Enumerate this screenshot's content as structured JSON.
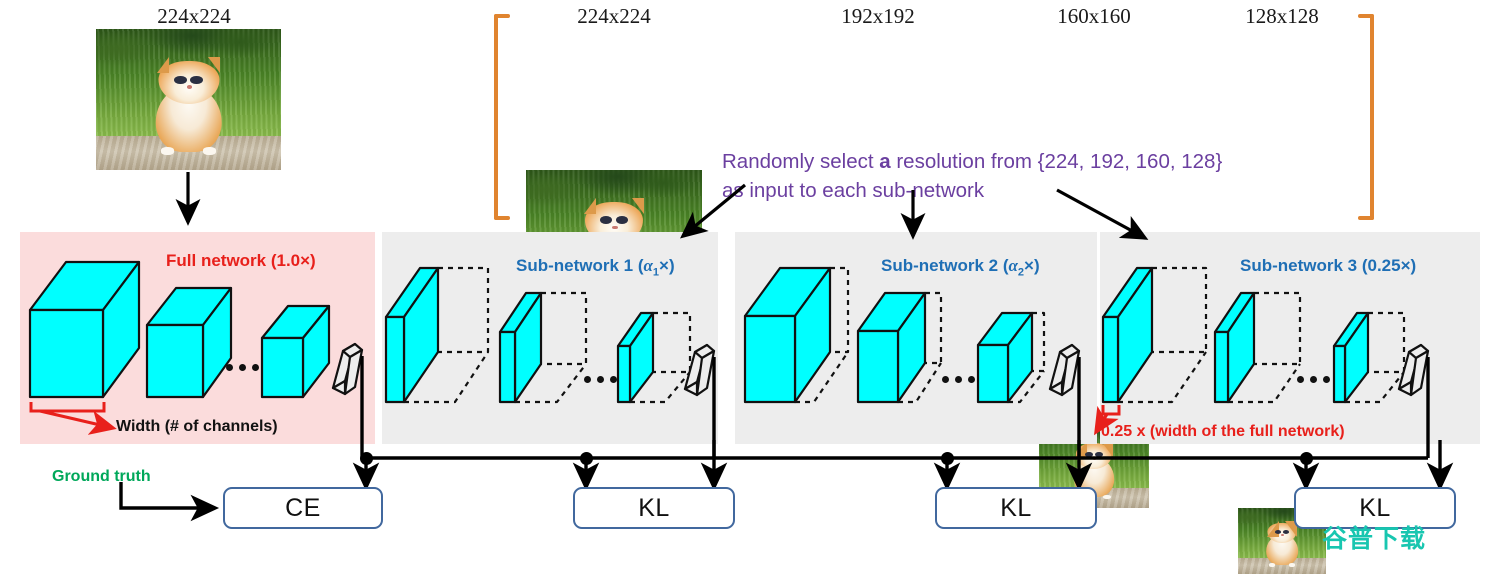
{
  "top_inputs": {
    "full_network_input": {
      "label": "224x224"
    },
    "bracket_group": [
      {
        "label": "224x224"
      },
      {
        "label": "192x192"
      },
      {
        "label": "160x160"
      },
      {
        "label": "128x128"
      }
    ]
  },
  "caption": {
    "line1_a": "Randomly select ",
    "line1_b": "a",
    "line1_c": " resolution from {224, 192, 160, 128}",
    "line2": "as input to each sub-network",
    "color": "#6B3FA0"
  },
  "panels": [
    {
      "id": "full",
      "title": "Full network (1.0×)",
      "title_color": "#E8201B",
      "bg": "#FBDCDC",
      "annotation": "Width (# of channels)",
      "annotation_color": "#121212"
    },
    {
      "id": "sub1",
      "title_prefix": "Sub-network 1 (",
      "title_sym": "α",
      "title_sub": "1",
      "title_suffix": "×)",
      "title_color": "#1F6FB5",
      "bg": "#EDEDED"
    },
    {
      "id": "sub2",
      "title_prefix": "Sub-network 2 (",
      "title_sym": "α",
      "title_sub": "2",
      "title_suffix": "×)",
      "title_color": "#1F6FB5",
      "bg": "#EDEDED"
    },
    {
      "id": "sub3",
      "title": "Sub-network 3 (0.25×)",
      "title_color": "#1F6FB5",
      "bg": "#EDEDED",
      "annotation": "0.25 x (width of the full network)",
      "annotation_color": "#E8201B"
    }
  ],
  "ground_truth": {
    "label": "Ground truth",
    "color": "#00A85A"
  },
  "losses": [
    {
      "label": "CE"
    },
    {
      "label": "KL"
    },
    {
      "label": "KL"
    },
    {
      "label": "KL"
    }
  ],
  "watermark": {
    "text": "谷普下载",
    "color": "#18C6B0"
  },
  "colors": {
    "cyan_block": "#00FFFF",
    "bracket_orange": "#E0842F",
    "loss_border": "#41689E",
    "wire": "#000000"
  },
  "icons": {
    "bracket": "curly-bracket-icon",
    "ellipsis": "ellipsis-icon",
    "classifier": "classifier-slab-icon",
    "arrow": "arrow-icon"
  }
}
